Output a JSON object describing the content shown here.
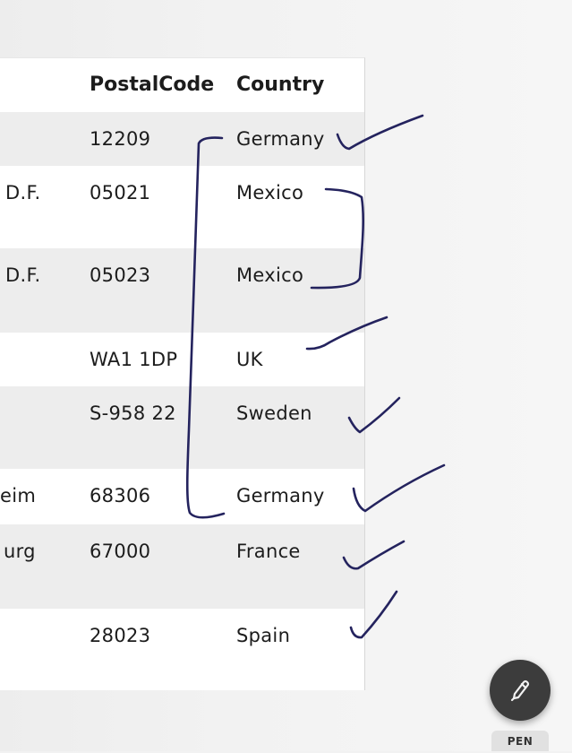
{
  "table": {
    "headers": {
      "postal": "PostalCode",
      "country": "Country"
    },
    "rows": [
      {
        "city_partial": "",
        "postal": "12209",
        "country": "Germany"
      },
      {
        "city_partial": "D.F.",
        "postal": "05021",
        "country": "Mexico"
      },
      {
        "city_partial": "D.F.",
        "postal": "05023",
        "country": "Mexico"
      },
      {
        "city_partial": "",
        "postal": "WA1 1DP",
        "country": "UK"
      },
      {
        "city_partial": "",
        "postal": "S-958 22",
        "country": "Sweden"
      },
      {
        "city_partial": "eim",
        "postal": "68306",
        "country": "Germany"
      },
      {
        "city_partial": "urg",
        "postal": "67000",
        "country": "France"
      },
      {
        "city_partial": "",
        "postal": "28023",
        "country": "Spain"
      }
    ]
  },
  "annotations": {
    "ink_color": "#24235e"
  },
  "pen_tool": {
    "label": "PEN",
    "icon": "pen-icon"
  }
}
